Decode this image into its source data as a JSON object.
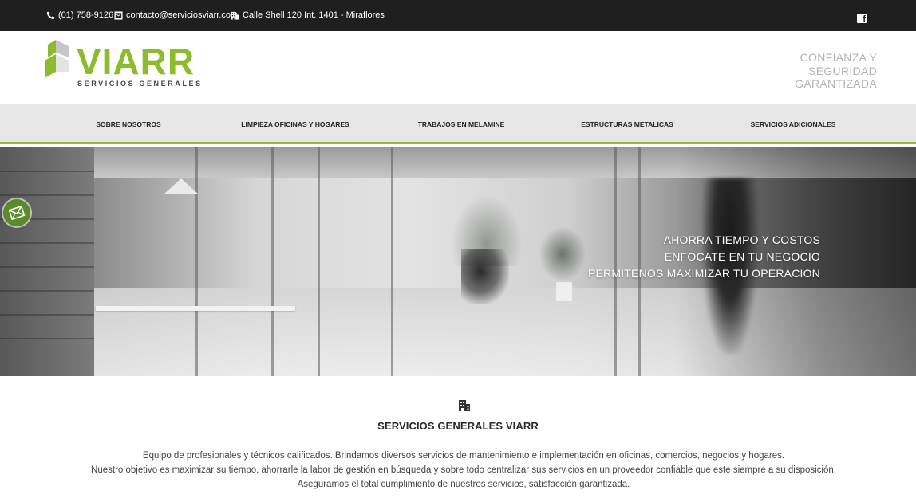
{
  "topbar": {
    "phone": "(01) 758-9126",
    "email": "contacto@serviciosviarr.com",
    "address": "Calle Shell 120 Int. 1401 - Miraflores"
  },
  "header": {
    "logo_word": "VIARR",
    "logo_tagline": "SERVICIOS GENERALES",
    "slogan": [
      "CONFIANZA Y",
      "SEGURIDAD",
      "GARANTIZADA"
    ]
  },
  "nav": [
    {
      "label": "SOBRE NOSOTROS"
    },
    {
      "label": "LIMPIEZA OFICINAS Y HOGARES"
    },
    {
      "label": "TRABAJOS EN MELAMINE"
    },
    {
      "label": "ESTRUCTURAS METALICAS"
    },
    {
      "label": "SERVICIOS ADICIONALES"
    }
  ],
  "hero": {
    "lines": [
      "AHORRA TIEMPO Y COSTOS",
      "ENFOCATE EN TU NEGOCIO",
      "PERMITENOS MAXIMIZAR TU OPERACION"
    ]
  },
  "section": {
    "title": "SERVICIOS GENERALES VIARR",
    "paragraphs": [
      "Equipo de profesionales y técnicos calificados. Brindamos diversos servicios de mantenimiento e implementación en oficinas, comercios, negocios y hogares.",
      "Nuestro objetivo es maximizar su tiempo, ahorrarle la labor de gestión en búsqueda y sobre todo centralizar sus servicios en un proveedor confiable que este siempre a su disposición.",
      "Aseguramos el total cumplimiento de nuestros servicios, satisfacción garantizada."
    ]
  },
  "colors": {
    "brand_green": "#8dbb2e",
    "topbar_bg": "#1f1f1f",
    "nav_bg": "#e6e6e6",
    "mail_button": "#5b8a28"
  },
  "icons": {
    "phone": "phone-icon",
    "email": "envelope-icon",
    "address": "building-icon",
    "social": "facebook-icon",
    "float": "mail-icon"
  }
}
